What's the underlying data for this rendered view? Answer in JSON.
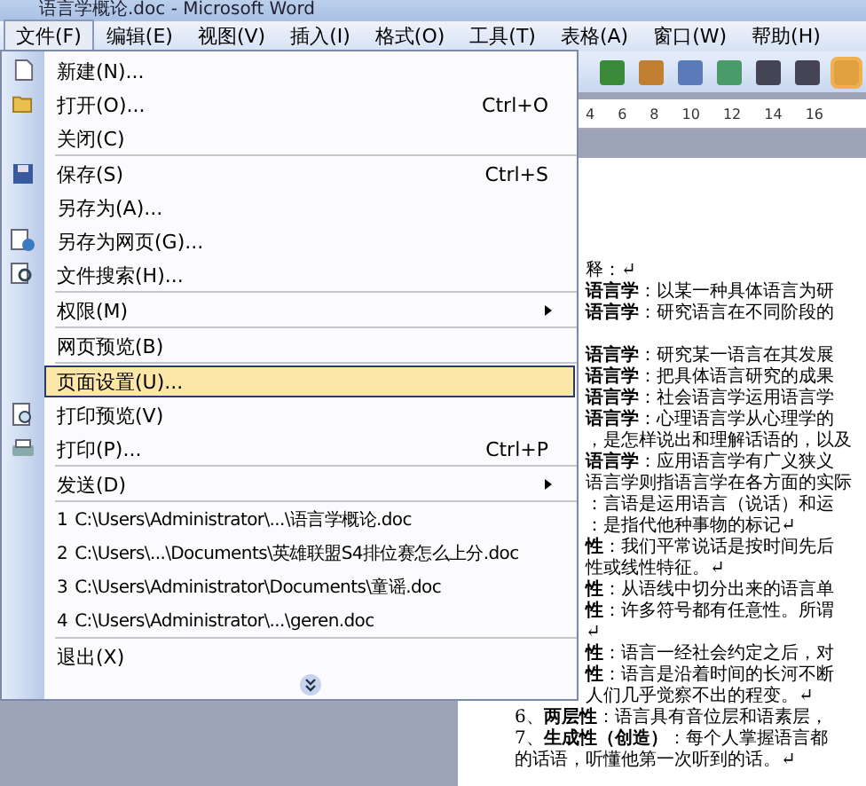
{
  "window": {
    "title": "语言学概论.doc - Microsoft Word"
  },
  "menu_bar": [
    {
      "label": "文件(F)",
      "selected": true
    },
    {
      "label": "编辑(E)",
      "selected": false
    },
    {
      "label": "视图(V)",
      "selected": false
    },
    {
      "label": "插入(I)",
      "selected": false
    },
    {
      "label": "格式(O)",
      "selected": false
    },
    {
      "label": "工具(T)",
      "selected": false
    },
    {
      "label": "表格(A)",
      "selected": false
    },
    {
      "label": "窗口(W)",
      "selected": false
    },
    {
      "label": "帮助(H)",
      "selected": false
    }
  ],
  "ruler": [
    "4",
    "6",
    "8",
    "10",
    "12",
    "14",
    "16"
  ],
  "file_menu": {
    "items": [
      {
        "kind": "item",
        "label": "新建(N)...",
        "selected": false
      },
      {
        "kind": "item",
        "label": "打开(O)...",
        "shortcut": "Ctrl+O",
        "selected": false
      },
      {
        "kind": "item",
        "label": "关闭(C)",
        "selected": false
      },
      {
        "kind": "separator"
      },
      {
        "kind": "item",
        "label": "保存(S)",
        "shortcut": "Ctrl+S",
        "selected": false
      },
      {
        "kind": "item",
        "label": "另存为(A)...",
        "selected": false
      },
      {
        "kind": "item",
        "label": "另存为网页(G)...",
        "selected": false
      },
      {
        "kind": "item",
        "label": "文件搜索(H)...",
        "selected": false
      },
      {
        "kind": "separator"
      },
      {
        "kind": "item",
        "label": "权限(M)",
        "submenu": true,
        "selected": false
      },
      {
        "kind": "separator"
      },
      {
        "kind": "item",
        "label": "网页预览(B)",
        "selected": false
      },
      {
        "kind": "separator"
      },
      {
        "kind": "item",
        "label": "页面设置(U)...",
        "selected": true
      },
      {
        "kind": "item",
        "label": "打印预览(V)",
        "selected": false
      },
      {
        "kind": "item",
        "label": "打印(P)...",
        "shortcut": "Ctrl+P",
        "selected": false
      },
      {
        "kind": "separator"
      },
      {
        "kind": "item",
        "label": "发送(D)",
        "submenu": true,
        "selected": false
      },
      {
        "kind": "separator"
      },
      {
        "kind": "recent",
        "number": "1",
        "label": "C:\\Users\\Administrator\\...\\语言学概论.doc",
        "selected": false
      },
      {
        "kind": "recent",
        "number": "2",
        "label": "C:\\Users\\...\\Documents\\英雄联盟S4排位赛怎么上分.doc",
        "selected": false
      },
      {
        "kind": "recent",
        "number": "3",
        "label": "C:\\Users\\Administrator\\Documents\\童谣.doc",
        "selected": false
      },
      {
        "kind": "recent",
        "number": "4",
        "label": "C:\\Users\\Administrator\\...\\geren.doc",
        "selected": false
      },
      {
        "kind": "separator"
      },
      {
        "kind": "item",
        "label": "退出(X)",
        "selected": false
      }
    ]
  },
  "document": {
    "lines": [
      {
        "kind": "cut",
        "text": "释：↵"
      },
      {
        "kind": "cut",
        "text": "**语言学**：以某一种具体语言为研"
      },
      {
        "kind": "cut",
        "text": "**语言学**：研究语言在不同阶段的"
      },
      {
        "kind": "blank"
      },
      {
        "kind": "cut",
        "text": "**语言学**：研究某一语言在其发展"
      },
      {
        "kind": "cut",
        "text": "**语言学**：把具体语言研究的成果"
      },
      {
        "kind": "cut",
        "text": "**语言学**：社会语言学运用语言学"
      },
      {
        "kind": "cut",
        "text": "**语言学**：心理语言学从心理学的"
      },
      {
        "kind": "cut",
        "text": "，是怎样说出和理解话语的，以及"
      },
      {
        "kind": "cut",
        "text": "**语言学**：应用语言学有广义狭义"
      },
      {
        "kind": "cut",
        "text": "语言学则指语言学在各方面的实际"
      },
      {
        "kind": "cut",
        "text": "：言语是运用语言（说话）和运"
      },
      {
        "kind": "cut",
        "text": "：是指代他种事物的标记↵"
      },
      {
        "kind": "cut",
        "text": "**性**：我们平常说话是按时间先后"
      },
      {
        "kind": "cut",
        "text": "性或线性特征。↵"
      },
      {
        "kind": "cut",
        "text": "**性**：从语线中切分出来的语言单"
      },
      {
        "kind": "cut",
        "text": "**性**：许多符号都有任意性。所谓"
      },
      {
        "kind": "cut",
        "text": "↵"
      },
      {
        "kind": "cut",
        "text": "**性**：语言一经社会约定之后，对"
      },
      {
        "kind": "cut",
        "text": "**性**：语言是沿着时间的长河不断"
      },
      {
        "kind": "cut",
        "text": "人们几乎觉察不出的程变。↵"
      },
      {
        "kind": "full",
        "text": "6、**两层性**：语言具有音位层和语素层，"
      },
      {
        "kind": "full",
        "text": "7、**生成性（创造）**：每个人掌握语言都"
      },
      {
        "kind": "full",
        "text": "的话语，听懂他第一次听到的话。↵"
      }
    ]
  }
}
